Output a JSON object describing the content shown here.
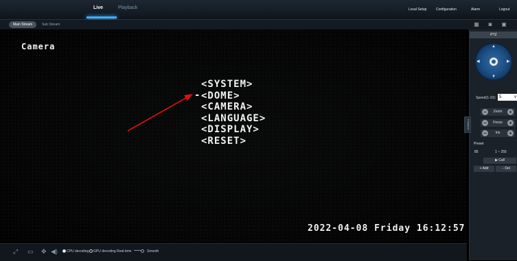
{
  "header": {
    "tabs": [
      {
        "label": "Live",
        "active": true
      },
      {
        "label": "Playback",
        "active": false
      }
    ],
    "nav": [
      "Local Setup",
      "Configuration",
      "Alarm",
      "Logout"
    ]
  },
  "subbar": {
    "streams": [
      {
        "label": "Main Stream",
        "active": true
      },
      {
        "label": "Sub Stream",
        "active": false
      }
    ],
    "tools": [
      "layout-icon",
      "snapshot-icon",
      "record-icon"
    ]
  },
  "video": {
    "camera_title": "Camera",
    "menu_cursor": "-",
    "menu_items": [
      "<SYSTEM>",
      "<DOME>",
      "<CAMERA>",
      "<LANGUAGE>",
      "<DISPLAY>",
      "<RESET>"
    ],
    "timestamp": "2022-04-08 Friday 16:12:57",
    "annotation_color": "#e01010"
  },
  "bottombar": {
    "cpu_decoding": "CPU decoding",
    "gpu_decoding": "GPU decoding",
    "mode_realtime": "Real-time",
    "mode_smooth": "Smooth",
    "decoding_selected": "CPU decoding"
  },
  "ptz": {
    "title": "PTZ",
    "speed_label": "Speed(1-10):",
    "speed_value": "5",
    "controls": [
      {
        "label": "Zoom",
        "minus": "−",
        "plus": "+"
      },
      {
        "label": "Focus",
        "minus": "−",
        "plus": "+"
      },
      {
        "label": "Iris",
        "minus": "−",
        "plus": "+"
      }
    ],
    "handle_label": "Collapse",
    "preset_label": "Preset",
    "preset_value": "85",
    "preset_range": "1 ~ 255",
    "call_label": "▶ Call",
    "add_label": "+ Add",
    "del_label": "− Del"
  },
  "colors": {
    "accent": "#3fb0ff",
    "joystick": "#1c4f84",
    "topbar": "#151d26"
  }
}
